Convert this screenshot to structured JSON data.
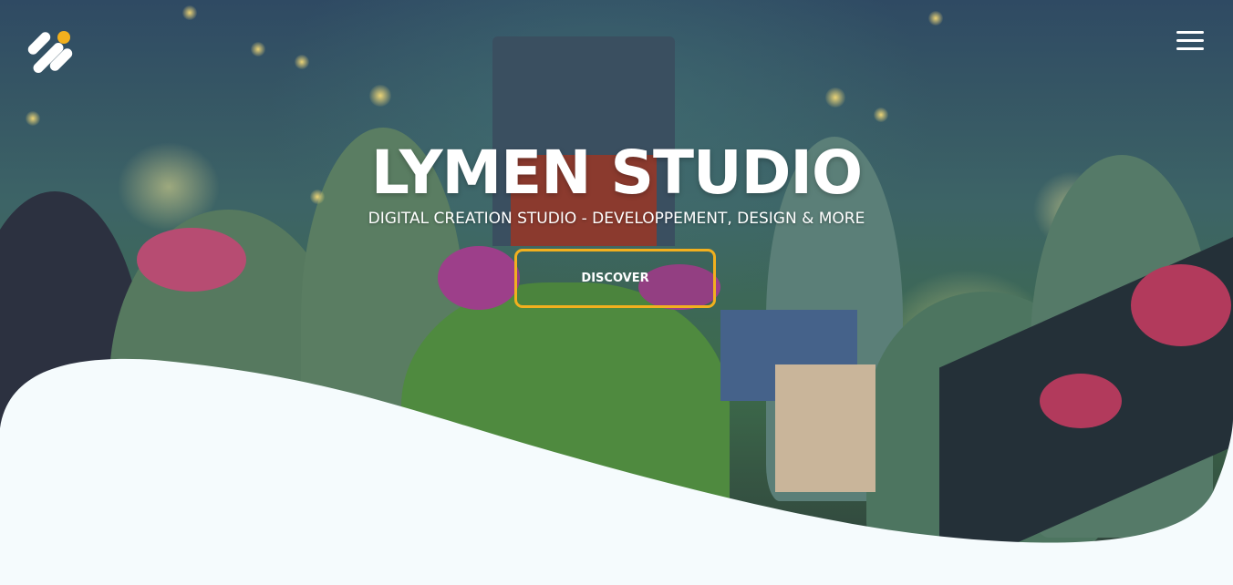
{
  "brand": {
    "logo_icon": "lymen-logo-icon",
    "title": "LYMEN STUDIO",
    "subtitle": "DIGITAL CREATION STUDIO - DEVELOPPEMENT, DESIGN & MORE"
  },
  "nav": {
    "menu_icon": "hamburger-menu-icon"
  },
  "hero": {
    "cta_label": "DISCOVER"
  },
  "colors": {
    "accent": "#f2b01e",
    "page_background": "#f5fbfd",
    "text": "#ffffff"
  }
}
